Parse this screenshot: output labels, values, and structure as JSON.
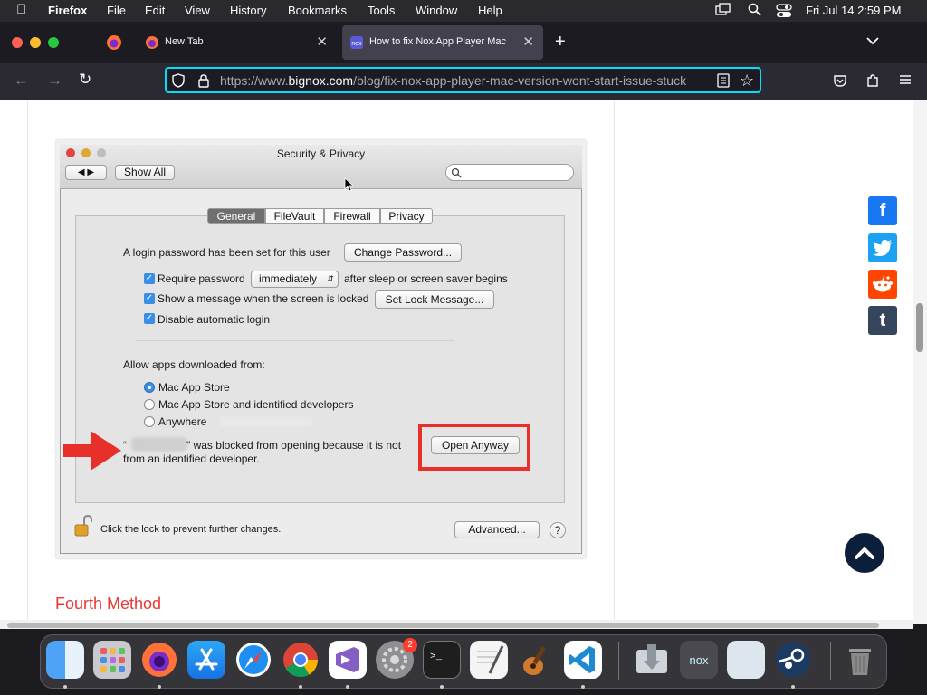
{
  "menubar": {
    "app": "Firefox",
    "items": [
      "File",
      "Edit",
      "View",
      "History",
      "Bookmarks",
      "Tools",
      "Window",
      "Help"
    ],
    "datetime": "Fri Jul 14  2:59 PM"
  },
  "tabs": [
    {
      "title": "New Tab"
    },
    {
      "title": "How to fix Nox App Player Mac"
    }
  ],
  "url": {
    "prefix": "https://www.",
    "host": "bignox.com",
    "path": "/blog/fix-nox-app-player-mac-version-wont-start-issue-stuck"
  },
  "prefs": {
    "title": "Security & Privacy",
    "show_all": "Show All",
    "tabs": [
      "General",
      "FileVault",
      "Firewall",
      "Privacy"
    ],
    "login_password": "A login password has been set for this user",
    "change_password": "Change Password...",
    "require_password": "Require password",
    "require_value": "immediately",
    "after_sleep": "after sleep or screen saver begins",
    "show_message": "Show a message when the screen is locked",
    "set_lock": "Set Lock Message...",
    "disable_login": "Disable automatic login",
    "allow_apps": "Allow apps downloaded from:",
    "radios": [
      "Mac App Store",
      "Mac App Store and identified developers",
      "Anywhere"
    ],
    "blocked_1": "\" was blocked from opening because it is not",
    "blocked_2": "from an identified developer.",
    "open_anyway": "Open Anyway",
    "lock_text": "Click the lock to prevent further changes.",
    "advanced": "Advanced...",
    "help": "?"
  },
  "article": {
    "heading": "Fourth Method"
  },
  "colors": {
    "accent_red": "#e53935",
    "arrow_red": "#e8302a",
    "focus_blue": "#00ddff"
  },
  "social": [
    "facebook-icon",
    "twitter-icon",
    "reddit-icon",
    "tumblr-icon"
  ],
  "dock": {
    "badge": "2"
  }
}
